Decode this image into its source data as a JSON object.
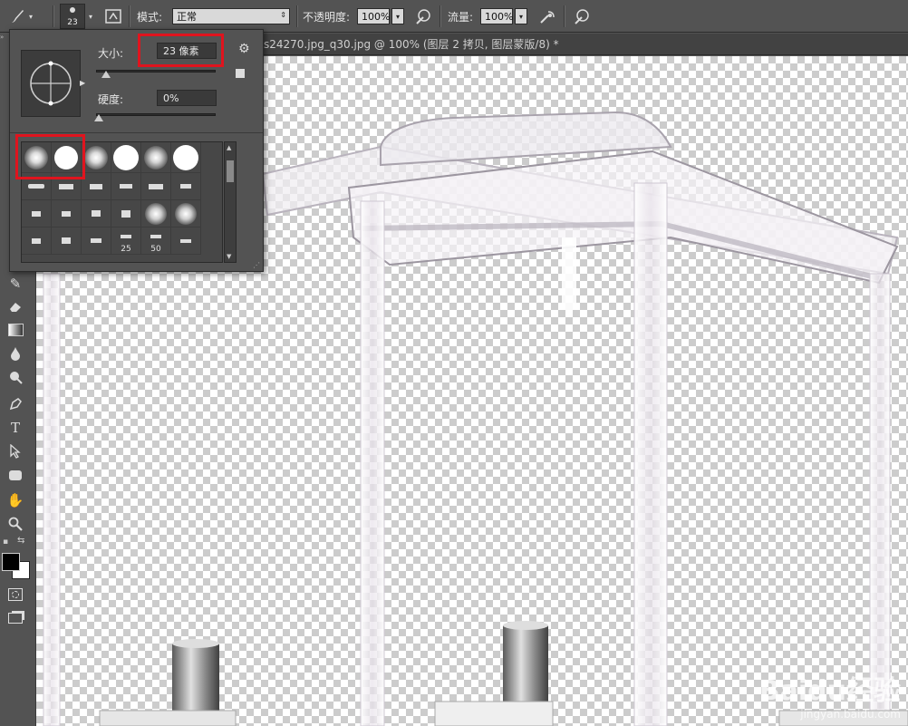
{
  "options_bar": {
    "brush_size_preview": "23",
    "mode_label": "模式:",
    "mode_value": "正常",
    "opacity_label": "不透明度:",
    "opacity_value": "100%",
    "flow_label": "流量:",
    "flow_value": "100%"
  },
  "document": {
    "tab_title": "s24270.jpg_q30.jpg @ 100% (图层 2 拷贝, 图层蒙版/8) *"
  },
  "brush_panel": {
    "size_label": "大小:",
    "size_value": "23 像素",
    "hardness_label": "硬度:",
    "hardness_value": "0%",
    "size_fraction": 0.08,
    "hardness_fraction": 0.0,
    "preset_labels": [
      "25",
      "50"
    ]
  },
  "watermark": {
    "brand": "Baidu经验",
    "url": "jingyan.baidu.com"
  },
  "colors": {
    "highlight": "#e0141e",
    "foreground": "#000000",
    "background": "#ffffff"
  }
}
